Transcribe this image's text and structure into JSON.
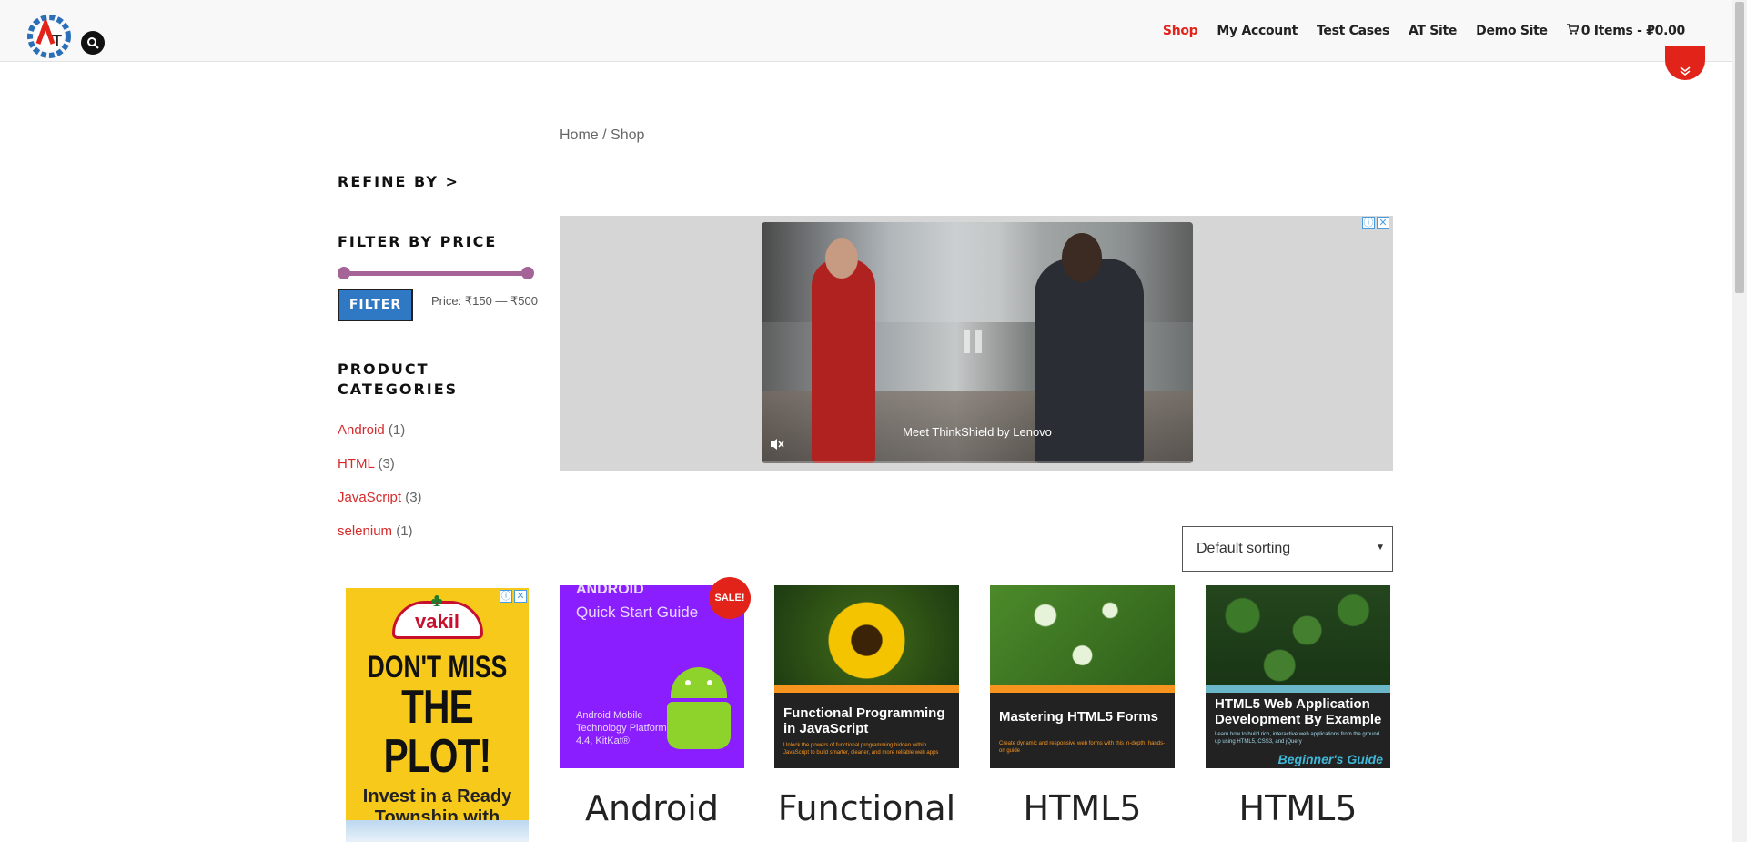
{
  "header": {
    "logo_text": "AT",
    "nav": [
      {
        "label": "Shop",
        "active": true
      },
      {
        "label": "My Account",
        "active": false
      },
      {
        "label": "Test Cases",
        "active": false
      },
      {
        "label": "AT Site",
        "active": false
      },
      {
        "label": "Demo Site",
        "active": false
      }
    ],
    "cart": {
      "label": "0 Items - ₽0.00",
      "icon": "cart-icon"
    },
    "accent_color": "#e2231a"
  },
  "breadcrumb": {
    "home": "Home",
    "separator": " / ",
    "current": "Shop"
  },
  "sidebar": {
    "refine_title": "REFINE BY >",
    "price_filter": {
      "title": "FILTER BY PRICE",
      "button": "FILTER",
      "price_label": "Price: ₹150 — ₹500",
      "slider_color": "#a46497"
    },
    "categories": {
      "title": "PRODUCT CATEGORIES",
      "items": [
        {
          "name": "Android",
          "count": "(1)"
        },
        {
          "name": "HTML",
          "count": "(3)"
        },
        {
          "name": "JavaScript",
          "count": "(3)"
        },
        {
          "name": "selenium",
          "count": "(1)"
        }
      ]
    }
  },
  "ads": {
    "main": {
      "caption": "Meet ThinkShield by Lenovo"
    },
    "side": {
      "brand": "vakil",
      "headline_1": "DON'T MISS",
      "headline_2": "THE PLOT!",
      "sub": "Invest in a Ready Township with Proven Returns"
    },
    "info_icon": "ⓘ",
    "close_icon": "✕"
  },
  "sorting": {
    "selected": "Default sorting"
  },
  "products": [
    {
      "title": "Android",
      "badge": "SALE!",
      "cover": {
        "line1": "ANDROID",
        "line2": "Quick Start Guide",
        "line3": "Android Mobile Technology Platform 4.4, KitKat®"
      }
    },
    {
      "title": "Functional",
      "cover": {
        "title": "Functional Programming in JavaScript",
        "desc": "Unlock the powers of functional programming hidden within JavaScript to build smarter, cleaner, and more reliable web apps"
      }
    },
    {
      "title": "HTML5",
      "cover": {
        "title": "Mastering HTML5 Forms",
        "desc": "Create dynamic and responsive web forms with this in-depth, hands-on guide"
      }
    },
    {
      "title": "HTML5",
      "cover": {
        "title": "HTML5 Web Application Development By Example",
        "desc": "Learn how to build rich, interactive web applications from the ground up using HTML5, CSS3, and jQuery",
        "series": "Beginner's Guide"
      }
    }
  ]
}
